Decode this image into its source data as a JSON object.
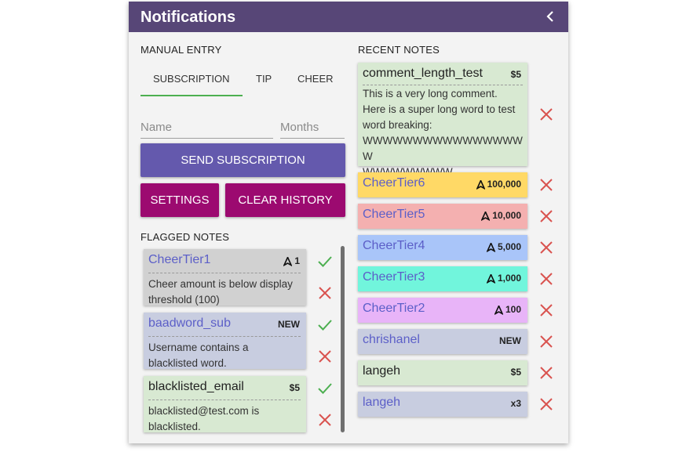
{
  "header": {
    "title": "Notifications"
  },
  "manual_entry": {
    "label": "MANUAL ENTRY",
    "tabs": [
      "SUBSCRIPTION",
      "TIP",
      "CHEER"
    ],
    "name_placeholder": "Name",
    "months_placeholder": "Months",
    "send_label": "SEND SUBSCRIPTION",
    "settings_label": "SETTINGS",
    "clear_label": "CLEAR HISTORY"
  },
  "flagged": {
    "label": "FLAGGED NOTES",
    "items": [
      {
        "name": "CheerTier1",
        "amount": "1",
        "msg1": "Cheer amount is below display",
        "msg2": "threshold (100)"
      },
      {
        "name": "baadword_sub",
        "amount": "NEW",
        "msg1": "Username contains a",
        "msg2": "blacklisted word."
      },
      {
        "name": "blacklisted_email",
        "amount": "$5",
        "msg1": "blacklisted@test.com is",
        "msg2": "blacklisted."
      }
    ]
  },
  "recent": {
    "label": "RECENT NOTES",
    "first": {
      "name": "comment_length_test",
      "amount": "$5",
      "lines": [
        "This is a very long comment.",
        "Here is a super long word to test",
        "word breaking:",
        "WWWWWWWWWWWWWWWWW",
        "WWWWWWWWW."
      ]
    },
    "items": [
      {
        "name": "CheerTier6",
        "amount": "100,000"
      },
      {
        "name": "CheerTier5",
        "amount": "10,000"
      },
      {
        "name": "CheerTier4",
        "amount": "5,000"
      },
      {
        "name": "CheerTier3",
        "amount": "1,000"
      },
      {
        "name": "CheerTier2",
        "amount": "100"
      },
      {
        "name": "chrishanel",
        "amount": "NEW"
      },
      {
        "name": "langeh",
        "amount": "$5"
      },
      {
        "name": "langeh_2",
        "amount": "x3",
        "display": "langeh"
      }
    ]
  },
  "colors": {
    "header": "#574677",
    "purple_button": "#6459ad",
    "magenta_button": "#9c0a70",
    "green_card": "#d8e9d2",
    "grey_card": "#d1d1d1",
    "blue_grey_card": "#c8cde0",
    "yellow_card": "#ffd966",
    "red_card": "#f4b0b0",
    "blue_card": "#a9c5f9",
    "cyan_card": "#71f5dc",
    "pink_card": "#e8b4f8",
    "accept": "#4caf50",
    "reject": "#d9534f"
  }
}
